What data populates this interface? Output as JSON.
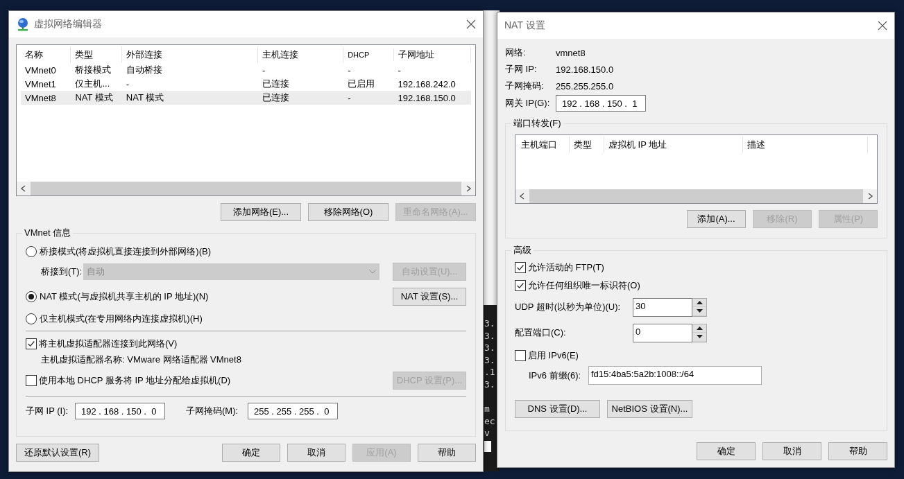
{
  "vnet_editor": {
    "title": "虚拟网络编辑器",
    "table": {
      "columns": [
        "名称",
        "类型",
        "外部连接",
        "主机连接",
        "DHCP",
        "子网地址"
      ],
      "rows": [
        {
          "cells": [
            "VMnet0",
            "桥接模式",
            "自动桥接",
            "-",
            "-",
            "-"
          ],
          "selected": false
        },
        {
          "cells": [
            "VMnet1",
            "仅主机...",
            "-",
            "已连接",
            "已启用",
            "192.168.242.0"
          ],
          "selected": false
        },
        {
          "cells": [
            "VMnet8",
            "NAT 模式",
            "NAT 模式",
            "已连接",
            "-",
            "192.168.150.0"
          ],
          "selected": true
        }
      ]
    },
    "table_buttons": [
      {
        "label": "添加网络(E)...",
        "disabled": false
      },
      {
        "label": "移除网络(O)",
        "disabled": false
      },
      {
        "label": "重命名网络(A)...",
        "disabled": true
      }
    ],
    "vmnet_info": {
      "legend": "VMnet 信息",
      "modes": [
        {
          "label": "桥接模式(将虚拟机直接连接到外部网络)(B)",
          "selected": false
        },
        {
          "label": "NAT 模式(与虚拟机共享主机的 IP 地址)(N)",
          "selected": true
        },
        {
          "label": "仅主机模式(在专用网络内连接虚拟机)(H)",
          "selected": false
        }
      ],
      "bridge_to": {
        "label": "桥接到(T):",
        "value": "自动",
        "disabled": true
      },
      "auto_settings_button": {
        "label": "自动设置(U)...",
        "disabled": true
      },
      "nat_settings_button": {
        "label": "NAT 设置(S)...",
        "disabled": false
      },
      "connect_adapter": {
        "label": "将主机虚拟适配器连接到此网络(V)",
        "checked": true
      },
      "adapter_name": "主机虚拟适配器名称: VMware 网络适配器 VMnet8",
      "use_dhcp": {
        "label": "使用本地 DHCP 服务将 IP 地址分配给虚拟机(D)",
        "checked": false
      },
      "dhcp_settings_button": {
        "label": "DHCP 设置(P)...",
        "disabled": true
      },
      "subnet_ip": {
        "label": "子网 IP (I):",
        "value": "192 . 168 . 150 .  0"
      },
      "subnet_mask": {
        "label": "子网掩码(M):",
        "value": "255 . 255 . 255 .  0"
      }
    },
    "footer_buttons": [
      {
        "label": "还原默认设置(R)",
        "disabled": false
      },
      {
        "label": "确定",
        "disabled": false
      },
      {
        "label": "取消",
        "disabled": false
      },
      {
        "label": "应用(A)",
        "disabled": true
      },
      {
        "label": "帮助",
        "disabled": false
      }
    ]
  },
  "background_terminal": {
    "lines_upper": [
      "3.",
      "3.",
      "3.",
      "3.",
      ".1",
      "3."
    ],
    "lines_lower": [
      "m",
      "ec",
      "v"
    ]
  },
  "nat_settings": {
    "title": "NAT 设置",
    "info": [
      {
        "label": "网络:",
        "value": "vmnet8"
      },
      {
        "label": "子网 IP:",
        "value": "192.168.150.0"
      },
      {
        "label": "子网掩码:",
        "value": "255.255.255.0"
      }
    ],
    "gateway": {
      "label": "网关 IP(G):",
      "value": "192 . 168 . 150 .  1"
    },
    "port_forwarding": {
      "legend": "端口转发(F)",
      "columns": [
        "主机端口",
        "类型",
        "虚拟机 IP 地址",
        "描述"
      ],
      "buttons": [
        {
          "label": "添加(A)...",
          "disabled": false
        },
        {
          "label": "移除(R)",
          "disabled": true
        },
        {
          "label": "属性(P)",
          "disabled": true
        }
      ]
    },
    "advanced": {
      "legend": "高级",
      "options": [
        {
          "label": "允许活动的 FTP(T)",
          "checked": true
        },
        {
          "label": "允许任何组织唯一标识符(O)",
          "checked": true
        }
      ],
      "spinners": [
        {
          "label": "UDP 超时(以秒为单位)(U):",
          "value": "30"
        },
        {
          "label": "配置端口(C):",
          "value": "0"
        }
      ],
      "ipv6": {
        "label": "启用 IPv6(E)",
        "checked": false
      },
      "ipv6_prefix": {
        "label": "IPv6 前缀(6):",
        "value": "fd15:4ba5:5a2b:1008::/64"
      },
      "buttons": [
        {
          "label": "DNS 设置(D)...",
          "disabled": false
        },
        {
          "label": "NetBIOS 设置(N)...",
          "disabled": false
        }
      ]
    },
    "footer_buttons": [
      {
        "label": "确定",
        "disabled": false
      },
      {
        "label": "取消",
        "disabled": false
      },
      {
        "label": "帮助",
        "disabled": false
      }
    ]
  }
}
